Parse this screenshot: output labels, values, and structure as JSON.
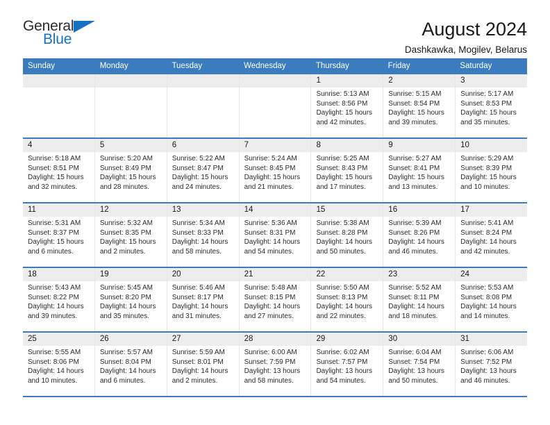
{
  "brand": {
    "name_part1": "General",
    "name_part2": "Blue",
    "accent_color": "#1471c4"
  },
  "header": {
    "title": "August 2024",
    "subtitle": "Dashkawka, Mogilev, Belarus"
  },
  "theme": {
    "header_blue": "#3a7cbe",
    "day_band_grey": "#ededed",
    "page_background": "#ffffff"
  },
  "weekdays": [
    "Sunday",
    "Monday",
    "Tuesday",
    "Wednesday",
    "Thursday",
    "Friday",
    "Saturday"
  ],
  "weeks": [
    [
      {
        "day": "",
        "sunrise": "",
        "sunset": "",
        "daylight_line1": "",
        "daylight_line2": ""
      },
      {
        "day": "",
        "sunrise": "",
        "sunset": "",
        "daylight_line1": "",
        "daylight_line2": ""
      },
      {
        "day": "",
        "sunrise": "",
        "sunset": "",
        "daylight_line1": "",
        "daylight_line2": ""
      },
      {
        "day": "",
        "sunrise": "",
        "sunset": "",
        "daylight_line1": "",
        "daylight_line2": ""
      },
      {
        "day": "1",
        "sunrise": "Sunrise: 5:13 AM",
        "sunset": "Sunset: 8:56 PM",
        "daylight_line1": "Daylight: 15 hours",
        "daylight_line2": "and 42 minutes."
      },
      {
        "day": "2",
        "sunrise": "Sunrise: 5:15 AM",
        "sunset": "Sunset: 8:54 PM",
        "daylight_line1": "Daylight: 15 hours",
        "daylight_line2": "and 39 minutes."
      },
      {
        "day": "3",
        "sunrise": "Sunrise: 5:17 AM",
        "sunset": "Sunset: 8:53 PM",
        "daylight_line1": "Daylight: 15 hours",
        "daylight_line2": "and 35 minutes."
      }
    ],
    [
      {
        "day": "4",
        "sunrise": "Sunrise: 5:18 AM",
        "sunset": "Sunset: 8:51 PM",
        "daylight_line1": "Daylight: 15 hours",
        "daylight_line2": "and 32 minutes."
      },
      {
        "day": "5",
        "sunrise": "Sunrise: 5:20 AM",
        "sunset": "Sunset: 8:49 PM",
        "daylight_line1": "Daylight: 15 hours",
        "daylight_line2": "and 28 minutes."
      },
      {
        "day": "6",
        "sunrise": "Sunrise: 5:22 AM",
        "sunset": "Sunset: 8:47 PM",
        "daylight_line1": "Daylight: 15 hours",
        "daylight_line2": "and 24 minutes."
      },
      {
        "day": "7",
        "sunrise": "Sunrise: 5:24 AM",
        "sunset": "Sunset: 8:45 PM",
        "daylight_line1": "Daylight: 15 hours",
        "daylight_line2": "and 21 minutes."
      },
      {
        "day": "8",
        "sunrise": "Sunrise: 5:25 AM",
        "sunset": "Sunset: 8:43 PM",
        "daylight_line1": "Daylight: 15 hours",
        "daylight_line2": "and 17 minutes."
      },
      {
        "day": "9",
        "sunrise": "Sunrise: 5:27 AM",
        "sunset": "Sunset: 8:41 PM",
        "daylight_line1": "Daylight: 15 hours",
        "daylight_line2": "and 13 minutes."
      },
      {
        "day": "10",
        "sunrise": "Sunrise: 5:29 AM",
        "sunset": "Sunset: 8:39 PM",
        "daylight_line1": "Daylight: 15 hours",
        "daylight_line2": "and 10 minutes."
      }
    ],
    [
      {
        "day": "11",
        "sunrise": "Sunrise: 5:31 AM",
        "sunset": "Sunset: 8:37 PM",
        "daylight_line1": "Daylight: 15 hours",
        "daylight_line2": "and 6 minutes."
      },
      {
        "day": "12",
        "sunrise": "Sunrise: 5:32 AM",
        "sunset": "Sunset: 8:35 PM",
        "daylight_line1": "Daylight: 15 hours",
        "daylight_line2": "and 2 minutes."
      },
      {
        "day": "13",
        "sunrise": "Sunrise: 5:34 AM",
        "sunset": "Sunset: 8:33 PM",
        "daylight_line1": "Daylight: 14 hours",
        "daylight_line2": "and 58 minutes."
      },
      {
        "day": "14",
        "sunrise": "Sunrise: 5:36 AM",
        "sunset": "Sunset: 8:31 PM",
        "daylight_line1": "Daylight: 14 hours",
        "daylight_line2": "and 54 minutes."
      },
      {
        "day": "15",
        "sunrise": "Sunrise: 5:38 AM",
        "sunset": "Sunset: 8:28 PM",
        "daylight_line1": "Daylight: 14 hours",
        "daylight_line2": "and 50 minutes."
      },
      {
        "day": "16",
        "sunrise": "Sunrise: 5:39 AM",
        "sunset": "Sunset: 8:26 PM",
        "daylight_line1": "Daylight: 14 hours",
        "daylight_line2": "and 46 minutes."
      },
      {
        "day": "17",
        "sunrise": "Sunrise: 5:41 AM",
        "sunset": "Sunset: 8:24 PM",
        "daylight_line1": "Daylight: 14 hours",
        "daylight_line2": "and 42 minutes."
      }
    ],
    [
      {
        "day": "18",
        "sunrise": "Sunrise: 5:43 AM",
        "sunset": "Sunset: 8:22 PM",
        "daylight_line1": "Daylight: 14 hours",
        "daylight_line2": "and 39 minutes."
      },
      {
        "day": "19",
        "sunrise": "Sunrise: 5:45 AM",
        "sunset": "Sunset: 8:20 PM",
        "daylight_line1": "Daylight: 14 hours",
        "daylight_line2": "and 35 minutes."
      },
      {
        "day": "20",
        "sunrise": "Sunrise: 5:46 AM",
        "sunset": "Sunset: 8:17 PM",
        "daylight_line1": "Daylight: 14 hours",
        "daylight_line2": "and 31 minutes."
      },
      {
        "day": "21",
        "sunrise": "Sunrise: 5:48 AM",
        "sunset": "Sunset: 8:15 PM",
        "daylight_line1": "Daylight: 14 hours",
        "daylight_line2": "and 27 minutes."
      },
      {
        "day": "22",
        "sunrise": "Sunrise: 5:50 AM",
        "sunset": "Sunset: 8:13 PM",
        "daylight_line1": "Daylight: 14 hours",
        "daylight_line2": "and 22 minutes."
      },
      {
        "day": "23",
        "sunrise": "Sunrise: 5:52 AM",
        "sunset": "Sunset: 8:11 PM",
        "daylight_line1": "Daylight: 14 hours",
        "daylight_line2": "and 18 minutes."
      },
      {
        "day": "24",
        "sunrise": "Sunrise: 5:53 AM",
        "sunset": "Sunset: 8:08 PM",
        "daylight_line1": "Daylight: 14 hours",
        "daylight_line2": "and 14 minutes."
      }
    ],
    [
      {
        "day": "25",
        "sunrise": "Sunrise: 5:55 AM",
        "sunset": "Sunset: 8:06 PM",
        "daylight_line1": "Daylight: 14 hours",
        "daylight_line2": "and 10 minutes."
      },
      {
        "day": "26",
        "sunrise": "Sunrise: 5:57 AM",
        "sunset": "Sunset: 8:04 PM",
        "daylight_line1": "Daylight: 14 hours",
        "daylight_line2": "and 6 minutes."
      },
      {
        "day": "27",
        "sunrise": "Sunrise: 5:59 AM",
        "sunset": "Sunset: 8:01 PM",
        "daylight_line1": "Daylight: 14 hours",
        "daylight_line2": "and 2 minutes."
      },
      {
        "day": "28",
        "sunrise": "Sunrise: 6:00 AM",
        "sunset": "Sunset: 7:59 PM",
        "daylight_line1": "Daylight: 13 hours",
        "daylight_line2": "and 58 minutes."
      },
      {
        "day": "29",
        "sunrise": "Sunrise: 6:02 AM",
        "sunset": "Sunset: 7:57 PM",
        "daylight_line1": "Daylight: 13 hours",
        "daylight_line2": "and 54 minutes."
      },
      {
        "day": "30",
        "sunrise": "Sunrise: 6:04 AM",
        "sunset": "Sunset: 7:54 PM",
        "daylight_line1": "Daylight: 13 hours",
        "daylight_line2": "and 50 minutes."
      },
      {
        "day": "31",
        "sunrise": "Sunrise: 6:06 AM",
        "sunset": "Sunset: 7:52 PM",
        "daylight_line1": "Daylight: 13 hours",
        "daylight_line2": "and 46 minutes."
      }
    ]
  ]
}
